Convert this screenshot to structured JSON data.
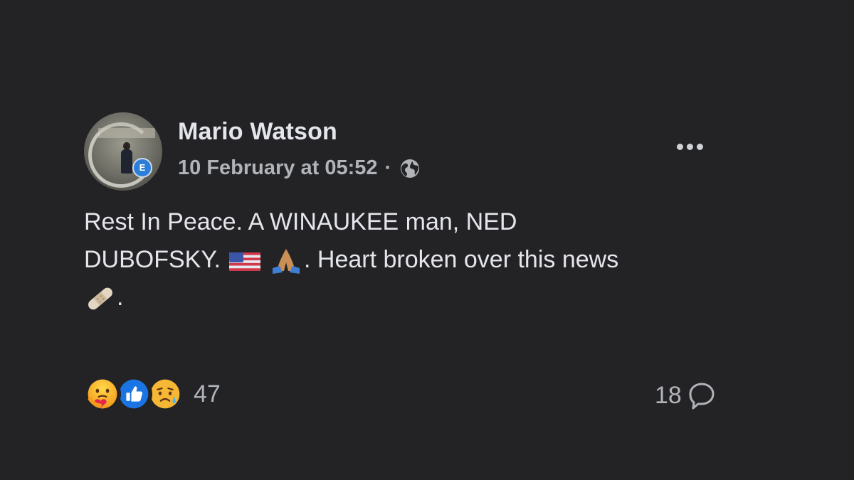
{
  "post": {
    "author": "Mario Watson",
    "timestamp": "10 February at 05:52",
    "separator": "·",
    "privacy_icon": "globe-icon",
    "avatar_badge": "E",
    "text_line1": "Rest In Peace. A WINAUKEE man, NED",
    "text_line2_a": "DUBOFSKY.",
    "text_line2_b": ". Heart broken over this news",
    "text_line3": ".",
    "emojis": [
      "us-flag-emoji",
      "folded-hands-emoji",
      "bandage-emoji"
    ],
    "reactions": {
      "icons": [
        "care-icon",
        "like-icon",
        "sad-icon"
      ],
      "count": "47"
    },
    "comments": {
      "count": "18",
      "icon": "comment-icon"
    },
    "more_icon": "more-options-icon"
  },
  "colors": {
    "background": "#232326",
    "primary_text": "#e4e6eb",
    "secondary_text": "#b0b3b8",
    "like_blue": "#1b74e4"
  }
}
